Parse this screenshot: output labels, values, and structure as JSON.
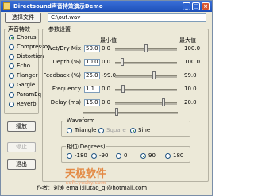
{
  "window": {
    "title": "Directsound声音特效演示Demo",
    "minimize_glyph": "_",
    "maximize_glyph": "□",
    "close_glyph": "×"
  },
  "toolbar": {
    "select_file_label": "选择文件",
    "file_path": "C:\\out.wav"
  },
  "effects": {
    "group_title": "声音特效",
    "items": [
      {
        "label": "Chorus",
        "checked": true
      },
      {
        "label": "Compressor",
        "checked": false
      },
      {
        "label": "Distortion",
        "checked": false
      },
      {
        "label": "Echo",
        "checked": false
      },
      {
        "label": "Flanger",
        "checked": false
      },
      {
        "label": "Gargle",
        "checked": false
      },
      {
        "label": "ParamEq",
        "checked": false
      },
      {
        "label": "Reverb",
        "checked": false
      }
    ]
  },
  "buttons": {
    "play": "播放",
    "stop": "停止",
    "exit": "退出"
  },
  "params": {
    "group_title": "参数设置",
    "min_header": "最小值",
    "max_header": "最大值",
    "rows": [
      {
        "label": "Wet/Dry Mix",
        "value": "50.0",
        "min": "0.0",
        "max": "100.0",
        "level": 0.5
      },
      {
        "label": "Depth (%)",
        "value": "10.0",
        "min": "0.0",
        "max": "100.0",
        "level": 0.1
      },
      {
        "label": "Feedback (%)",
        "value": "25.0",
        "min": "-99.0",
        "max": "99.0",
        "level": 0.63
      },
      {
        "label": "Frequency",
        "value": "1.1",
        "min": "0.0",
        "max": "10.0",
        "level": 0.11
      },
      {
        "label": "Delay (ms)",
        "value": "16.0",
        "min": "0.0",
        "max": "20.0",
        "level": 0.8
      }
    ],
    "extra_slider_level": 0.35
  },
  "waveform": {
    "group_title": "Waveform",
    "options": [
      {
        "label": "Triangle",
        "checked": false,
        "enabled": true
      },
      {
        "label": "Square",
        "checked": false,
        "enabled": false
      },
      {
        "label": "Sine",
        "checked": true,
        "enabled": true
      }
    ]
  },
  "phase": {
    "group_title": "相位(Degrees)",
    "options": [
      {
        "label": "-180",
        "checked": false
      },
      {
        "label": "-90",
        "checked": false
      },
      {
        "label": "0",
        "checked": false
      },
      {
        "label": "90",
        "checked": true
      },
      {
        "label": "180",
        "checked": false
      }
    ]
  },
  "watermark": {
    "text": "天极软件",
    "url": "soft.yesky.com"
  },
  "footer": {
    "text": "作者：刘涛 email:liutao_ql@hotmail.com"
  },
  "colors": {
    "title_bar": "#1c4fb8",
    "close_button": "#d8542f",
    "window_bg": "#ece9d8"
  }
}
